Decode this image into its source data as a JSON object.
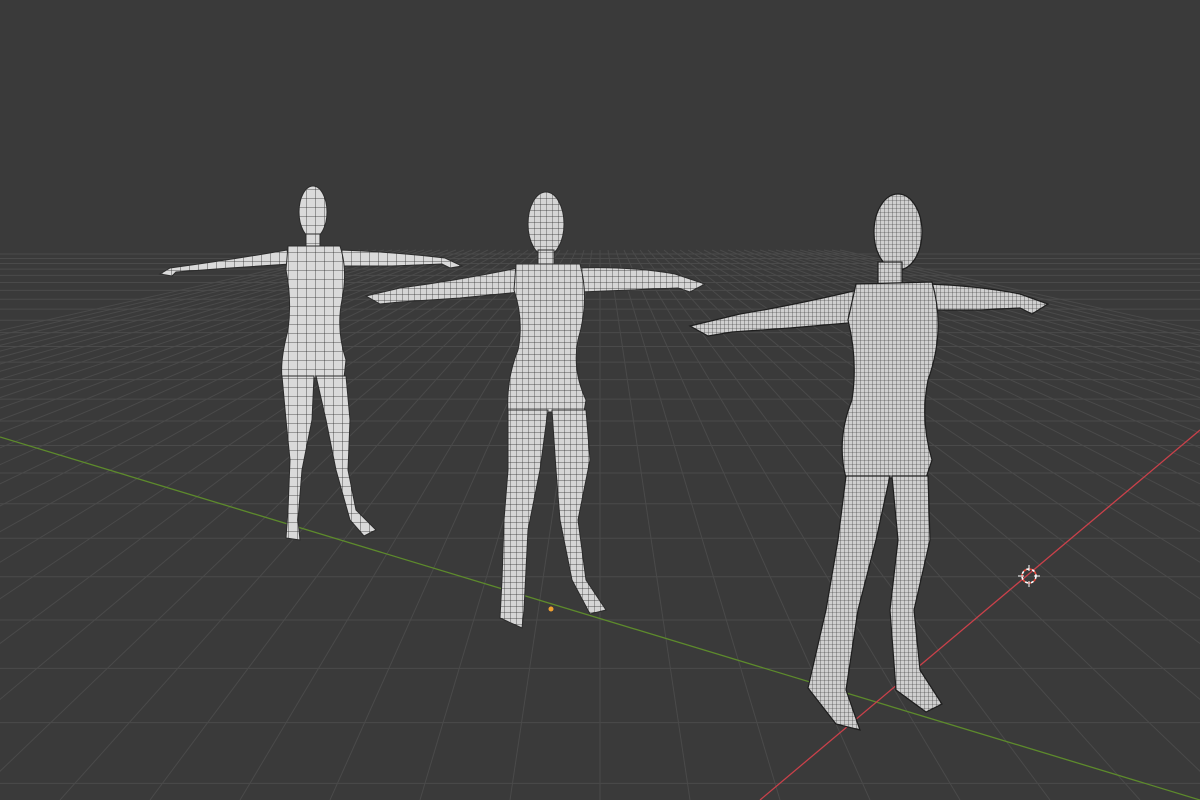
{
  "viewport": {
    "background": "#3a3a3a",
    "grid_color": "#4a4a4a",
    "x_axis_color": "#c9414a",
    "y_axis_color": "#5d8a2c"
  },
  "scene": {
    "objects": [
      {
        "name": "low-density-figure",
        "fill": "#d9d9d9",
        "wire": "#2b2b2b"
      },
      {
        "name": "medium-density-figure",
        "fill": "#d4d4d4",
        "wire": "#2b2b2b"
      },
      {
        "name": "high-density-figure",
        "fill": "#c8c8c8",
        "wire": "#262626"
      }
    ],
    "cursor_color": "#e84a3c",
    "origin_color": "#f0a030"
  }
}
